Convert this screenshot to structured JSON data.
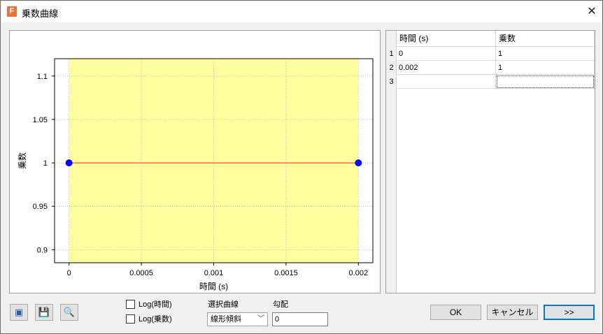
{
  "window": {
    "title": "乗数曲線",
    "app_icon_letter": "F"
  },
  "chart_data": {
    "type": "scatter",
    "series": [
      {
        "x": [
          0,
          0.002
        ],
        "y": [
          1,
          1
        ]
      }
    ],
    "x_ticks": [
      "0",
      "0.0005",
      "0.001",
      "0.0015",
      "0.002"
    ],
    "y_ticks": [
      "1.1",
      "1.05",
      "1",
      "0.95",
      "0.9"
    ],
    "xlabel": "時間 (s)",
    "ylabel": "乗数",
    "xlim": [
      -0.0001,
      0.0021
    ],
    "ylim": [
      0.885,
      1.12
    ],
    "highlight_region": [
      0,
      0.002
    ],
    "grid": true,
    "colors": {
      "line": "#ff3300",
      "marker": "#0000ff",
      "highlight": "#ffffa0"
    }
  },
  "table": {
    "columns": [
      "時間 (s)",
      "乗数"
    ],
    "rows": [
      {
        "num": "1",
        "time": "0",
        "multiplier": "1"
      },
      {
        "num": "2",
        "time": "0.002",
        "multiplier": "1"
      },
      {
        "num": "3",
        "time": "",
        "multiplier": ""
      }
    ]
  },
  "toolbar": {
    "icons": [
      "reset-icon",
      "save-icon",
      "zoom-icon"
    ]
  },
  "options": {
    "log_time_label": "Log(時間)",
    "log_multiplier_label": "Log(乗数)",
    "curve_select_label": "選択曲線",
    "curve_select_value": "線形傾斜",
    "slope_label": "勾配",
    "slope_value": "0"
  },
  "buttons": {
    "ok": "OK",
    "cancel": "キャンセル",
    "expand": ">>"
  }
}
